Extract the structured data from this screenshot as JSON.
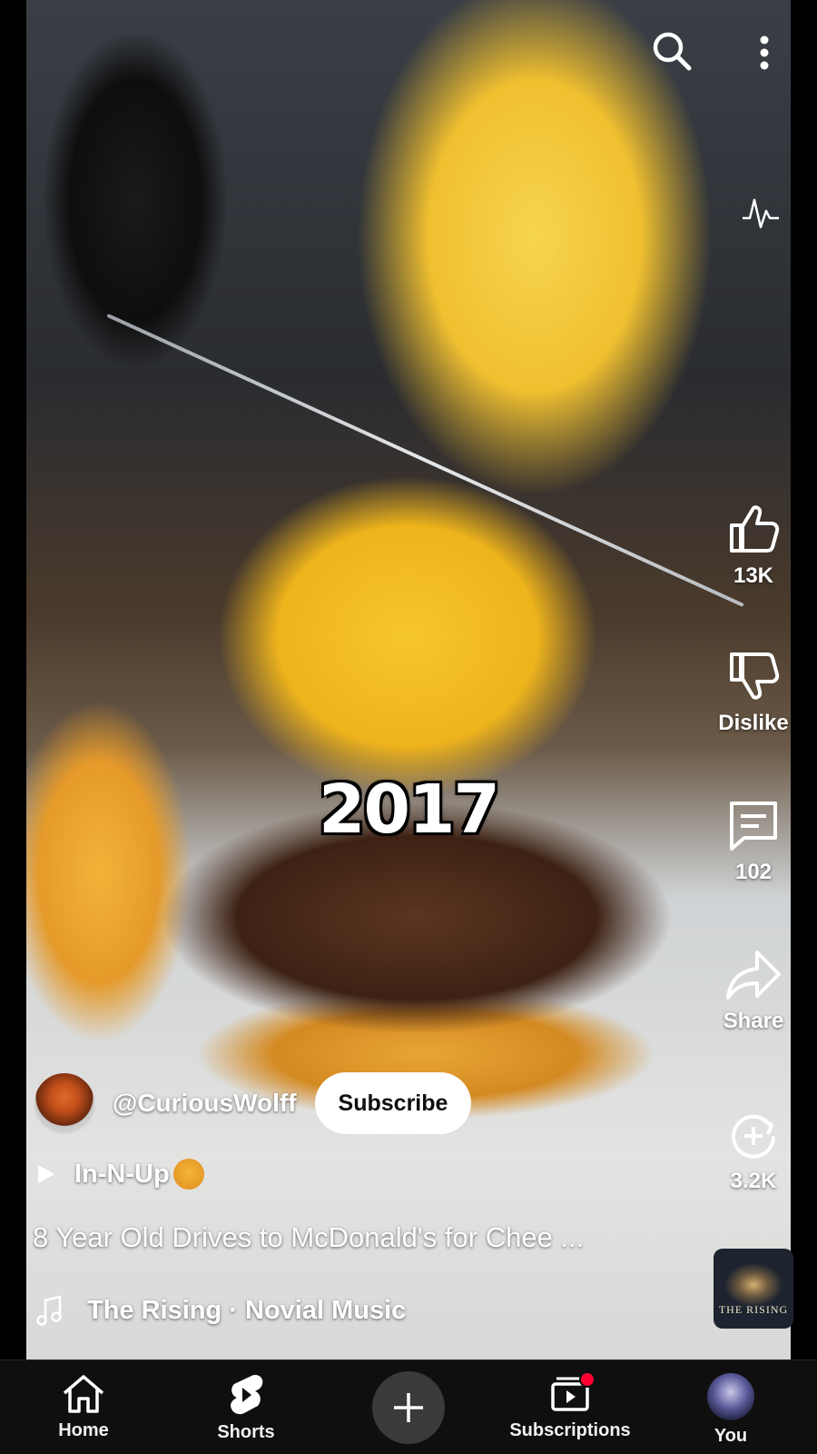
{
  "video": {
    "overlay_text": "2017",
    "channel_handle": "@CuriousWolff",
    "subscribe_label": "Subscribe",
    "playlist_label": "In-N-Up",
    "title": "8 Year Old Drives to McDonald's for Chee ...",
    "music": "The Rising · Novial Music",
    "album_art_text": "THE RISING"
  },
  "top_bar": {
    "search_icon": "search-icon",
    "more_icon": "more-vertical-icon",
    "pulse_icon": "sound-wave-icon"
  },
  "actions": {
    "like_count": "13K",
    "dislike_label": "Dislike",
    "comment_count": "102",
    "share_label": "Share",
    "remix_count": "3.2K"
  },
  "bottom_nav": {
    "home": "Home",
    "shorts": "Shorts",
    "subscriptions": "Subscriptions",
    "you": "You"
  },
  "colors": {
    "nav_bg": "#0f0f0f",
    "badge": "#ff0033",
    "subscribe_bg": "#ffffff"
  }
}
